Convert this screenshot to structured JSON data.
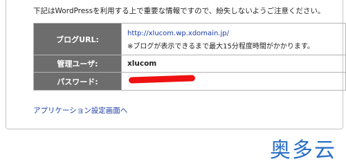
{
  "notice": "下記はWordPressを利用する上で重要な情報ですので、紛失しないようご注意ください。",
  "table": {
    "blog_url_label": "ブログURL:",
    "blog_url_value": "http://xlucom.wp.xdomain.jp/",
    "blog_url_note": "※ブログが表示できるまで最大15分程度時間がかかります。",
    "admin_user_label": "管理ユーザ:",
    "admin_user_value": "xlucom",
    "password_label": "パスワード:"
  },
  "app_link": "アプリケーション設定画面へ",
  "watermark": "奥多云",
  "colors": {
    "header_bg": "#6d6d6d",
    "link": "#1a3da8",
    "redaction": "#ee1111",
    "watermark": "#2a6fc8"
  }
}
